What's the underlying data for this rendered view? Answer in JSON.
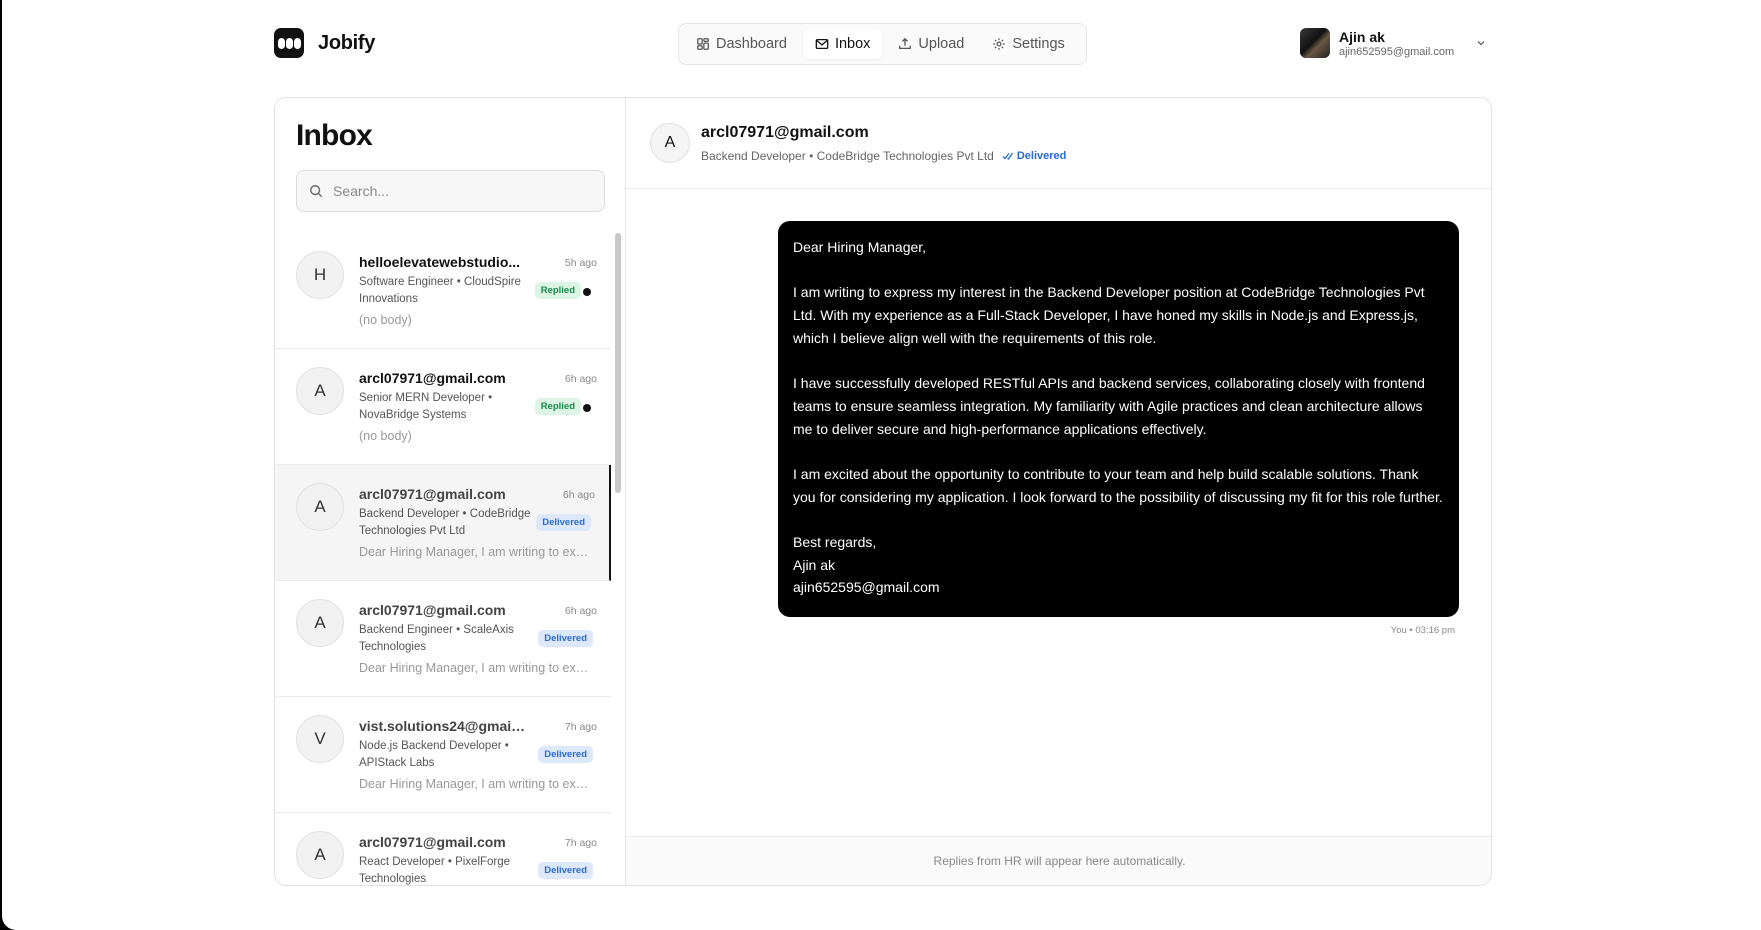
{
  "app": {
    "name": "Jobify"
  },
  "nav": [
    {
      "label": "Dashboard",
      "icon": "dashboard-icon"
    },
    {
      "label": "Inbox",
      "icon": "mail-icon",
      "active": true
    },
    {
      "label": "Upload",
      "icon": "upload-icon"
    },
    {
      "label": "Settings",
      "icon": "gear-icon"
    }
  ],
  "user": {
    "name": "Ajin ak",
    "email": "ajin652595@gmail.com"
  },
  "inbox": {
    "title": "Inbox",
    "search_placeholder": "Search...",
    "items": [
      {
        "initial": "H",
        "from": "helloelevatewebstudio...",
        "time": "5h ago",
        "subject": "Software Engineer • CloudSpire Innovations",
        "preview": "(no body)",
        "status": "Replied",
        "unread": true
      },
      {
        "initial": "A",
        "from": "arcl07971@gmail.com",
        "time": "6h ago",
        "subject": "Senior MERN Developer • NovaBridge Systems",
        "preview": "(no body)",
        "status": "Replied",
        "unread": true
      },
      {
        "initial": "A",
        "from": "arcl07971@gmail.com",
        "time": "6h ago",
        "subject": "Backend Developer • CodeBridge Technologies Pvt Ltd",
        "preview": "Dear Hiring Manager, I am writing to expr...",
        "status": "Delivered",
        "selected": true
      },
      {
        "initial": "A",
        "from": "arcl07971@gmail.com",
        "time": "6h ago",
        "subject": "Backend Engineer • ScaleAxis Technologies",
        "preview": "Dear Hiring Manager, I am writing to expr...",
        "status": "Delivered"
      },
      {
        "initial": "V",
        "from": "vist.solutions24@gmail.com",
        "time": "7h ago",
        "subject": "Node.js Backend Developer • APIStack Labs",
        "preview": "Dear Hiring Manager, I am writing to expr...",
        "status": "Delivered"
      },
      {
        "initial": "A",
        "from": "arcl07971@gmail.com",
        "time": "7h ago",
        "subject": "React Developer • PixelForge Technologies",
        "preview": "",
        "status": "Delivered"
      }
    ]
  },
  "thread": {
    "initial": "A",
    "from": "arcl07971@gmail.com",
    "subtitle": "Backend Developer • CodeBridge Technologies Pvt Ltd",
    "status": "Delivered",
    "message": {
      "greeting": "Dear Hiring Manager,",
      "p1": "I am writing to express my interest in the Backend Developer position at CodeBridge Technologies Pvt Ltd. With my experience as a Full-Stack Developer, I have honed my skills in Node.js and Express.js, which I believe align well with the requirements of this role.",
      "p2": "I have successfully developed RESTful APIs and backend services, collaborating closely with frontend teams to ensure seamless integration. My familiarity with Agile practices and clean architecture allows me to deliver secure and high-performance applications effectively.",
      "p3": "I am excited about the opportunity to contribute to your team and help build scalable solutions. Thank you for considering my application. I look forward to the possibility of discussing my fit for this role further.",
      "signoff": "Best regards,",
      "sig_name": "Ajin ak",
      "sig_email": "ajin652595@gmail.com"
    },
    "meta": "You • 03:16 pm",
    "footer": "Replies from HR will appear here automatically."
  }
}
